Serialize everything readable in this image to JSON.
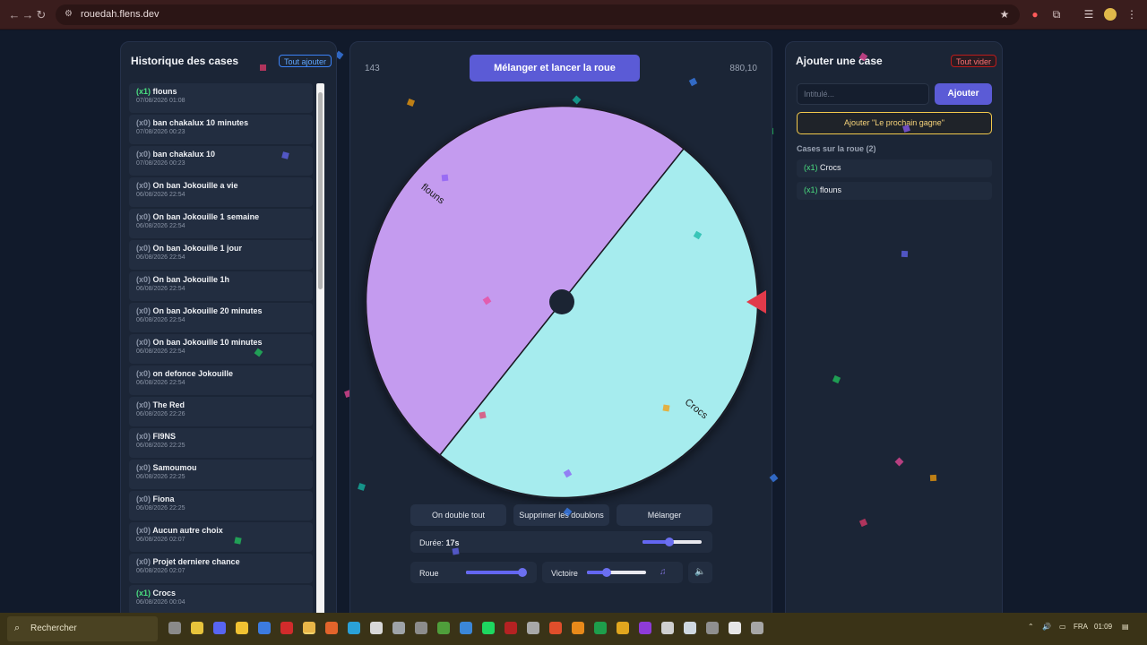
{
  "browser": {
    "url": "rouedah.flens.dev"
  },
  "history": {
    "title": "Historique des cases",
    "add_all_label": "Tout ajouter",
    "items": [
      {
        "count": "(x1)",
        "winner": true,
        "name": "flouns",
        "date": "07/08/2026 01:08"
      },
      {
        "count": "(x0)",
        "winner": false,
        "name": "ban chakalux 10 minutes",
        "date": "07/08/2026 00:23"
      },
      {
        "count": "(x0)",
        "winner": false,
        "name": "ban chakalux 10",
        "date": "07/08/2026 00:23"
      },
      {
        "count": "(x0)",
        "winner": false,
        "name": "On ban Jokouille a vie",
        "date": "06/08/2026 22:54"
      },
      {
        "count": "(x0)",
        "winner": false,
        "name": "On ban Jokouille 1 semaine",
        "date": "06/08/2026 22:54"
      },
      {
        "count": "(x0)",
        "winner": false,
        "name": "On ban Jokouille 1 jour",
        "date": "06/08/2026 22:54"
      },
      {
        "count": "(x0)",
        "winner": false,
        "name": "On ban Jokouille 1h",
        "date": "06/08/2026 22:54"
      },
      {
        "count": "(x0)",
        "winner": false,
        "name": "On ban Jokouille 20 minutes",
        "date": "06/08/2026 22:54"
      },
      {
        "count": "(x0)",
        "winner": false,
        "name": "On ban Jokouille 10 minutes",
        "date": "06/08/2026 22:54"
      },
      {
        "count": "(x0)",
        "winner": false,
        "name": "on defonce Jokouille",
        "date": "06/08/2026 22:54"
      },
      {
        "count": "(x0)",
        "winner": false,
        "name": "The Red",
        "date": "06/08/2026 22:26"
      },
      {
        "count": "(x0)",
        "winner": false,
        "name": "FI9NS",
        "date": "06/08/2026 22:25"
      },
      {
        "count": "(x0)",
        "winner": false,
        "name": "Samoumou",
        "date": "06/08/2026 22:25"
      },
      {
        "count": "(x0)",
        "winner": false,
        "name": "Fiona",
        "date": "06/08/2026 22:25"
      },
      {
        "count": "(x0)",
        "winner": false,
        "name": "Aucun autre choix",
        "date": "06/08/2026 02:07"
      },
      {
        "count": "(x0)",
        "winner": false,
        "name": "Projet derniere chance",
        "date": "06/08/2026 02:07"
      },
      {
        "count": "(x1)",
        "winner": true,
        "name": "Crocs",
        "date": "06/08/2026 00:04"
      }
    ]
  },
  "wheel": {
    "spin_label": "Mélanger et lancer la roue",
    "left_stat": "143",
    "right_stat": "880,10",
    "segments": [
      {
        "label": "flouns",
        "color": "#c49bef"
      },
      {
        "label": "Crocs",
        "color": "#a6ecee"
      }
    ],
    "pointer_color": "#e23a4a"
  },
  "controls": {
    "double_all": "On double tout",
    "remove_duplicates": "Supprimer les doublons",
    "shuffle": "Mélanger",
    "duration_label": "Durée:",
    "duration_value": "17s",
    "duration_level": 0.45,
    "wheel_label": "Roue",
    "wheel_volume": 0.95,
    "victory_label": "Victoire",
    "victory_volume": 0.33
  },
  "add_panel": {
    "title": "Ajouter une case",
    "clear_label": "Tout vider",
    "input_placeholder": "Intitulé...",
    "add_label": "Ajouter",
    "next_wins_label": "Ajouter \"Le prochain gagne\"",
    "cases_title": "Cases sur la roue (2)",
    "cases": [
      {
        "count": "(x1)",
        "name": "Crocs"
      },
      {
        "count": "(x1)",
        "name": "flouns"
      }
    ]
  },
  "taskbar": {
    "search_label": "Rechercher",
    "lang": "FRA",
    "time": "01:09"
  },
  "colors": {
    "accent": "#5b5bd6",
    "winner_green": "#4ade80",
    "danger": "#ef4444",
    "warning": "#f2c94c"
  }
}
